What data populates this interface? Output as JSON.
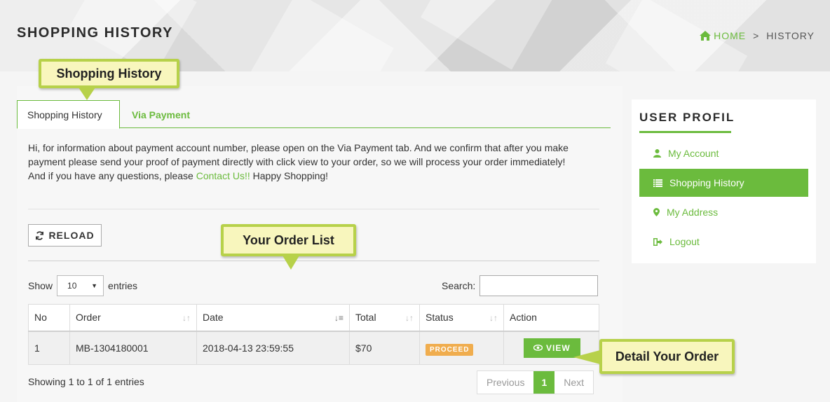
{
  "header": {
    "title": "SHOPPING HISTORY",
    "breadcrumb": {
      "home": "HOME",
      "separator": ">",
      "current": "HISTORY"
    }
  },
  "tabs": [
    {
      "label": "Shopping History",
      "active": true
    },
    {
      "label": "Via Payment",
      "active": false
    }
  ],
  "info": {
    "line1": "Hi, for information about payment account number, please open on the Via Payment tab. And we confirm that after you make payment please send your proof of payment directly with click view to your order, so we will process your order immediately!",
    "line2_prefix": "And if you have any questions, please ",
    "contact_link": "Contact Us!!",
    "line2_suffix": " Happy Shopping!"
  },
  "reload_label": "RELOAD",
  "table_controls": {
    "show_label": "Show",
    "entries_value": "10",
    "entries_label": "entries",
    "search_label": "Search:"
  },
  "table": {
    "headers": [
      "No",
      "Order",
      "Date",
      "Total",
      "Status",
      "Action"
    ],
    "rows": [
      {
        "no": "1",
        "order": "MB-1304180001",
        "date": "2018-04-13 23:59:55",
        "total": "$70",
        "status": "PROCEED",
        "action": "VIEW"
      }
    ]
  },
  "footer": {
    "showing": "Showing 1 to 1 of 1 entries",
    "prev": "Previous",
    "page": "1",
    "next": "Next"
  },
  "sidebar": {
    "title": "USER PROFIL",
    "items": [
      {
        "label": "My Account",
        "icon": "user-icon",
        "active": false
      },
      {
        "label": "Shopping History",
        "icon": "list-icon",
        "active": true
      },
      {
        "label": "My Address",
        "icon": "map-marker-icon",
        "active": false
      },
      {
        "label": "Logout",
        "icon": "sign-out-icon",
        "active": false
      }
    ]
  },
  "callouts": {
    "tab": "Shopping History",
    "list": "Your Order List",
    "detail": "Detail Your Order"
  },
  "colors": {
    "accent": "#6bbb3d",
    "warning": "#f0ad4e",
    "callout_bg": "#f8f6bd",
    "callout_border": "#b7d14a"
  }
}
